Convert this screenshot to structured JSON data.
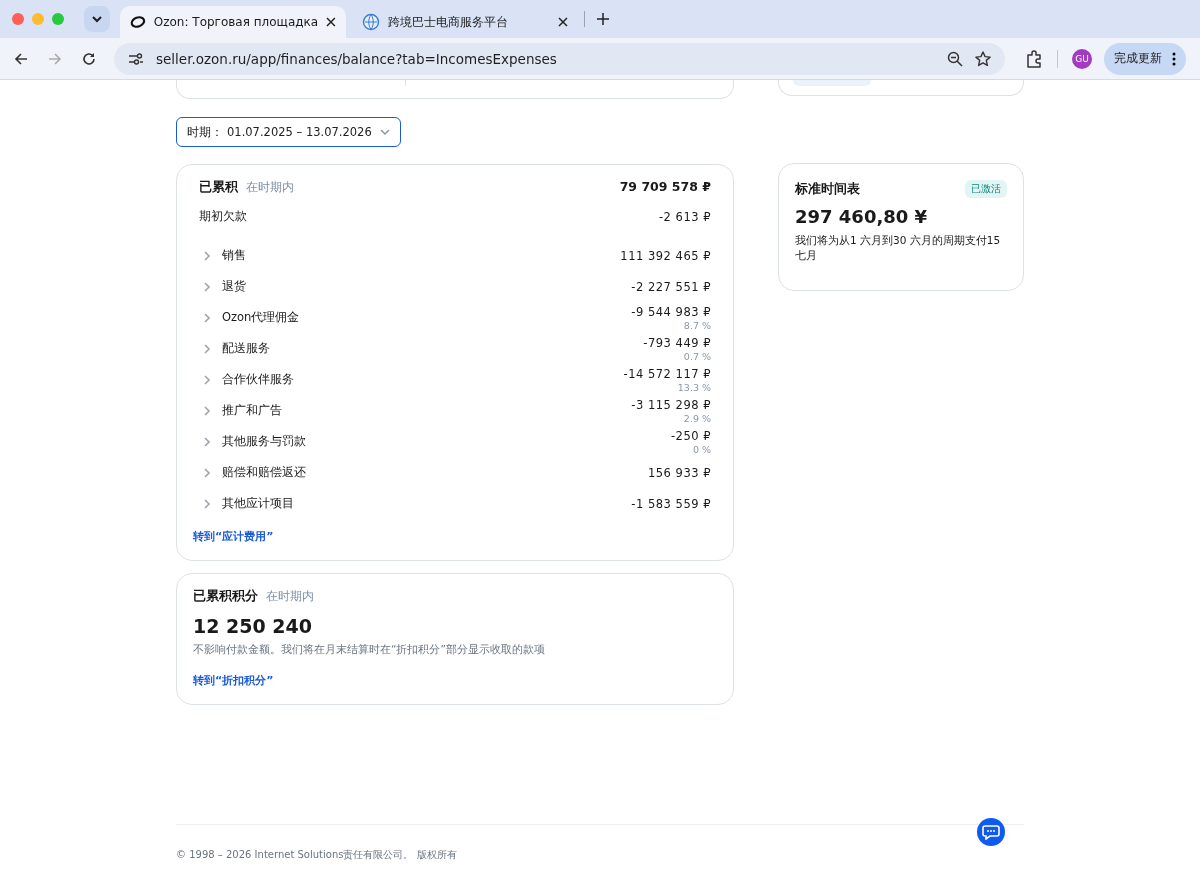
{
  "browser": {
    "tabs": [
      {
        "title": "Ozon: Торговая площадка",
        "selected": true,
        "kind": "ozon"
      },
      {
        "title": "跨境巴士电商服务平台",
        "selected": false,
        "kind": "globe"
      }
    ],
    "url": "seller.ozon.ru/app/finances/balance?tab=IncomesExpenses",
    "profile": "GU",
    "update_button": "完成更新"
  },
  "period": {
    "label": "时期：",
    "value": "01.07.2025 – 13.07.2026"
  },
  "accrued": {
    "title": "已累积",
    "subtitle": "在时期内",
    "total": "79 709 578 ₽",
    "rows": [
      {
        "kind": "plain",
        "label": "期初欠款",
        "amount": "-2 613 ₽"
      },
      {
        "kind": "expandable",
        "label": "销售",
        "amount": "111 392 465 ₽"
      },
      {
        "kind": "expandable",
        "label": "退货",
        "amount": "-2 227 551 ₽"
      },
      {
        "kind": "expandable",
        "label": "Ozon代理佣金",
        "amount": "-9 544 983 ₽",
        "percent": "8.7 %"
      },
      {
        "kind": "expandable",
        "label": "配送服务",
        "amount": "-793 449 ₽",
        "percent": "0.7 %"
      },
      {
        "kind": "expandable",
        "label": "合作伙伴服务",
        "amount": "-14 572 117 ₽",
        "percent": "13.3 %"
      },
      {
        "kind": "expandable",
        "label": "推广和广告",
        "amount": "-3 115 298 ₽",
        "percent": "2.9 %"
      },
      {
        "kind": "expandable",
        "label": "其他服务与罚款",
        "amount": "-250 ₽",
        "percent": "0 %"
      },
      {
        "kind": "expandable",
        "label": "赔偿和赔偿返还",
        "amount": "156 933 ₽"
      },
      {
        "kind": "expandable",
        "label": "其他应计项目",
        "amount": "-1 583 559 ₽"
      }
    ],
    "link": "转到“应计费用”"
  },
  "points": {
    "title": "已累积积分",
    "subtitle": "在时期内",
    "value": "12 250 240",
    "note": "不影响付款金额。我们将在月末结算时在“折扣积分”部分显示收取的款项",
    "link": "转到“折扣积分”"
  },
  "schedule": {
    "title": "标准时间表",
    "badge": "已激活",
    "amount": "297 460,80 ¥",
    "note": "我们将为从1 六月到30 六月的周期支付15 七月"
  },
  "footer": "© 1998 – 2026 Internet Solutions责任有限公司。 版权所有"
}
